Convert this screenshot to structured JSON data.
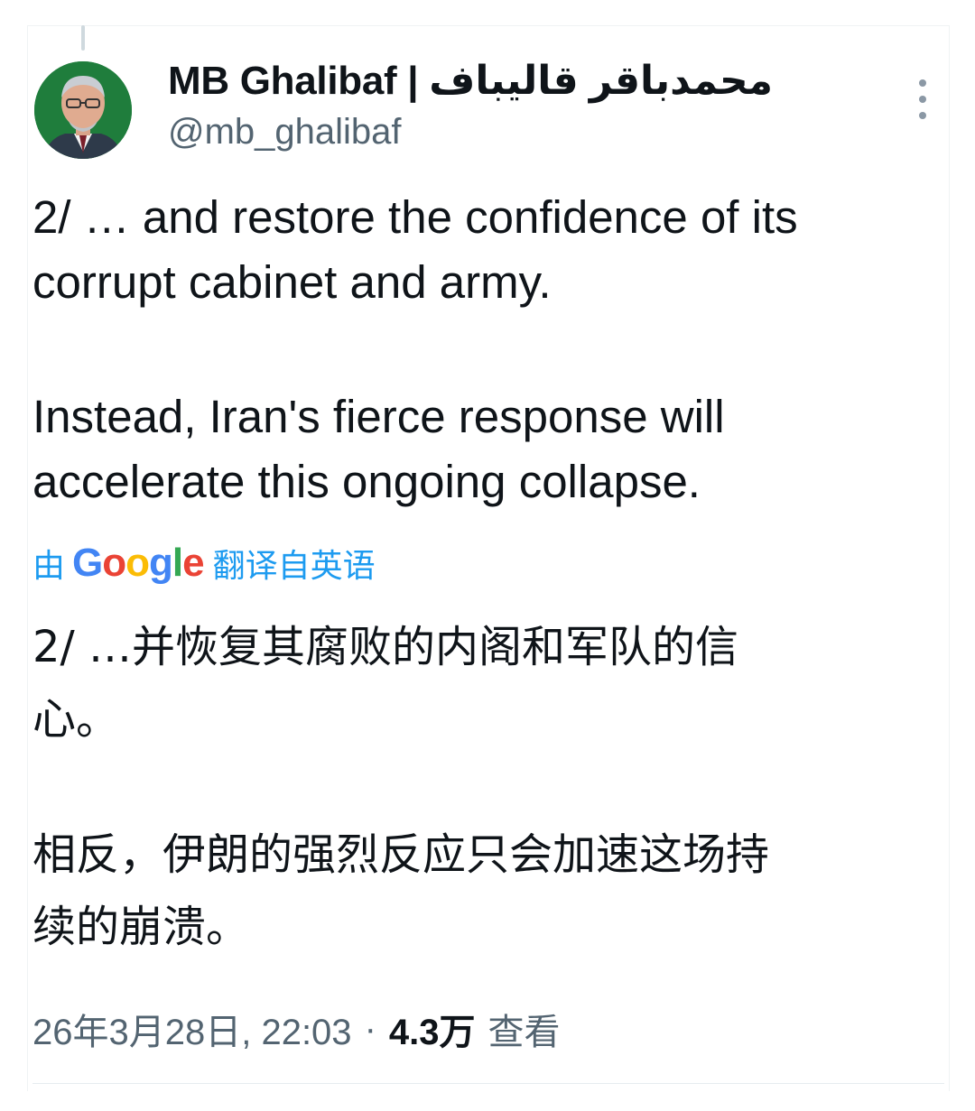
{
  "tweet": {
    "display_name": "MB Ghalibaf | محمدباقر قالیباف",
    "handle": "@mb_ghalibaf",
    "text_p1": "2/ … and restore the confidence of its\ncorrupt cabinet and army.",
    "text_p2": "Instead, Iran's fierce response will\naccelerate this ongoing collapse.",
    "translation_prefix": "由",
    "translation_brand": [
      "G",
      "o",
      "o",
      "g",
      "l",
      "e"
    ],
    "translation_suffix": "翻译自英语",
    "translated_p1": "2/ …并恢复其腐败的内阁和军队的信\n心。",
    "translated_p2": "相反，伊朗的强烈反应只会加速这场持\n续的崩溃。",
    "timestamp": "26年3月28日, 22:03",
    "separator": "·",
    "views_count": "4.3万",
    "views_label": "查看"
  },
  "icons": {
    "avatar": "profile-photo",
    "more": "more-vertical-icon"
  },
  "colors": {
    "text": "#0f1419",
    "secondary": "#536471",
    "link": "#1d9bf0",
    "thread_line": "#cfd9de"
  }
}
